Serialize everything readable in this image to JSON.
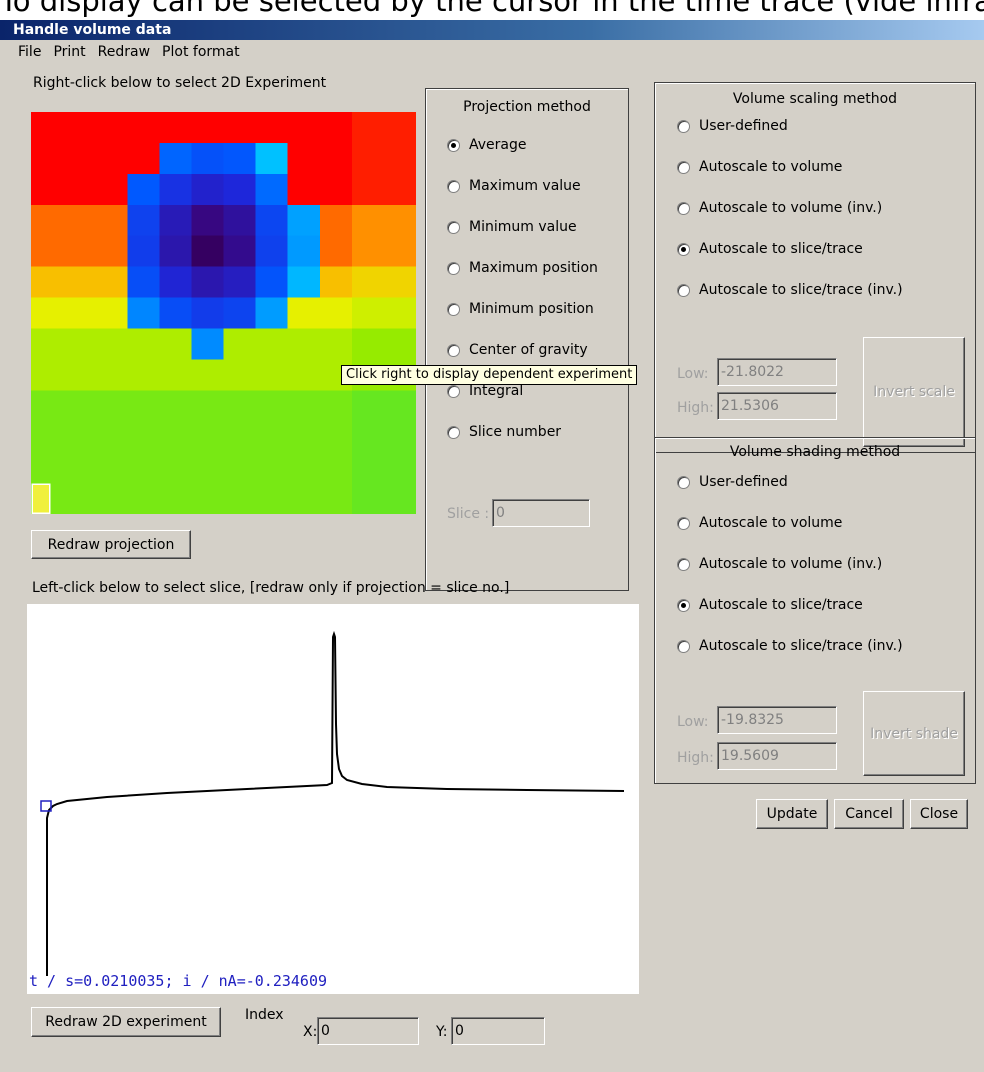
{
  "page_caption": "To display can be selected by the cursor in the time trace (vide infra).",
  "window": {
    "title": "Handle volume data"
  },
  "menu": [
    "File",
    "Print",
    "Redraw",
    "Plot format"
  ],
  "projection_panel": {
    "label": "Right-click below to select 2D Experiment",
    "redraw_button": "Redraw projection",
    "tooltip": "Click right to display dependent experiment"
  },
  "projection_method": {
    "title": "Projection method",
    "options": [
      "Average",
      "Maximum value",
      "Minimum value",
      "Maximum position",
      "Minimum position",
      "Center of gravity",
      "Integral",
      "Slice number"
    ],
    "selected": "Average",
    "slice_label": "Slice :",
    "slice_value": "0"
  },
  "volume_scaling": {
    "title": "Volume scaling method",
    "options": [
      "User-defined",
      "Autoscale to volume",
      "Autoscale to volume (inv.)",
      "Autoscale to slice/trace",
      "Autoscale to slice/trace (inv.)"
    ],
    "selected": "Autoscale to slice/trace",
    "low_label": "Low:",
    "low_value": "-21.8022",
    "high_label": "High:",
    "high_value": "21.5306",
    "invert_button": "Invert scale"
  },
  "volume_shading": {
    "title": "Volume shading method",
    "options": [
      "User-defined",
      "Autoscale to volume",
      "Autoscale to volume (inv.)",
      "Autoscale to slice/trace",
      "Autoscale to slice/trace (inv.)"
    ],
    "selected": "Autoscale to slice/trace",
    "low_label": "Low:",
    "low_value": "-19.8325",
    "high_label": "High:",
    "high_value": "19.5609",
    "invert_button": "Invert shade"
  },
  "dialog_buttons": {
    "update": "Update",
    "cancel": "Cancel",
    "close": "Close"
  },
  "trace_panel": {
    "label": "Left-click below to select slice, [redraw only if projection = slice no.]",
    "readout": "t / s=0.0210035; i / nA=-0.234609",
    "redraw_button": "Redraw 2D experiment",
    "index_label": "Index",
    "x_label": "X:",
    "x_value": "0",
    "y_label": "Y:",
    "y_value": "0"
  },
  "colors": {
    "dialog_bg": "#d4d0c8",
    "title_gradient_start": "#0a246a",
    "title_gradient_end": "#a6caf0",
    "readout_text": "#2020c0",
    "tooltip_bg": "#ffffe1",
    "selection_marker": "#2020c0"
  }
}
